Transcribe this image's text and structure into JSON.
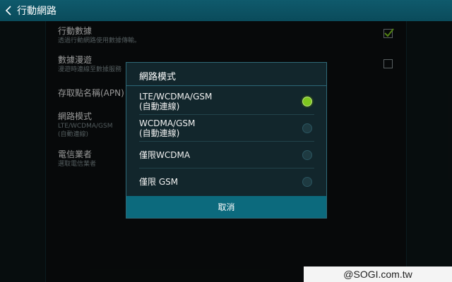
{
  "actionbar": {
    "title": "行動網路"
  },
  "settings": [
    {
      "title": "行動數據",
      "summary": "透過行動網路使用數據傳輸。",
      "checked": true
    },
    {
      "title": "數據漫遊",
      "summary": "漫遊時連線至數據服務",
      "checked": false
    },
    {
      "title": "存取點名稱(APN)",
      "summary": ""
    },
    {
      "title": "網路模式",
      "summary_line1": "LTE/WCDMA/GSM",
      "summary_line2": "(自動連線)"
    },
    {
      "title": "電信業者",
      "summary": "選取電信業者"
    }
  ],
  "dialog": {
    "title": "網路模式",
    "options": [
      {
        "line1": "LTE/WCDMA/GSM",
        "line2": "(自動連線)",
        "selected": true
      },
      {
        "line1": "WCDMA/GSM",
        "line2": "(自動連線)",
        "selected": false
      },
      {
        "line1": "僅限WCDMA",
        "line2": "",
        "selected": false
      },
      {
        "line1": "僅限 GSM",
        "line2": "",
        "selected": false
      }
    ],
    "cancel_label": "取消"
  },
  "watermark": {
    "text": "@SOGI.com.tw"
  },
  "colors": {
    "actionbar": "#0a4b5b",
    "accent": "#7ec61f",
    "cancel": "#0c6a7d"
  }
}
